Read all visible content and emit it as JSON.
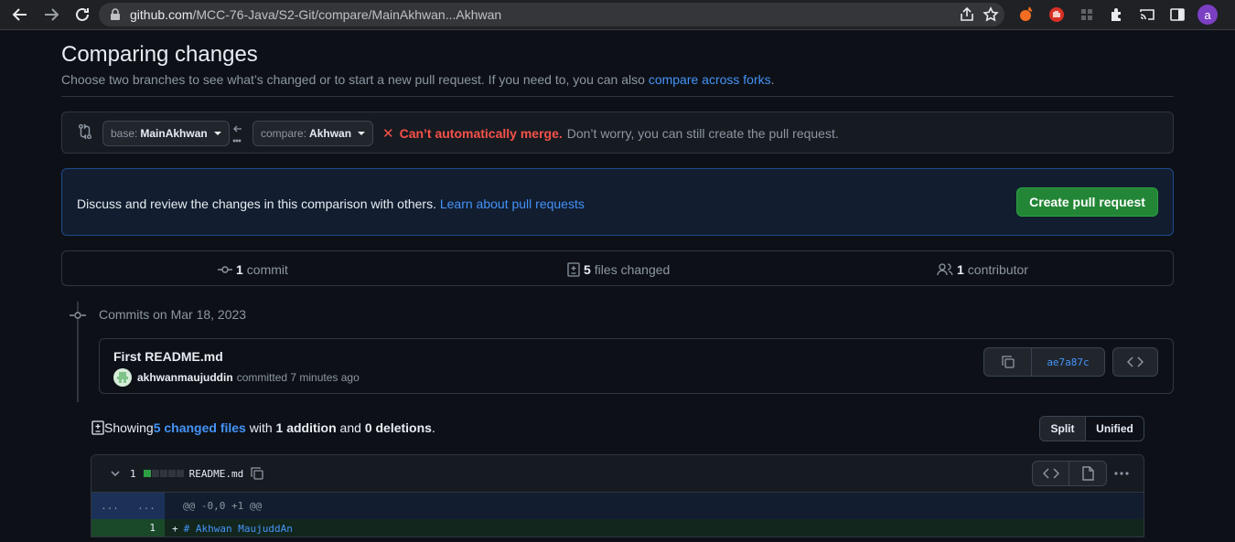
{
  "browser": {
    "url_host": "github.com",
    "url_path": "/MCC-76-Java/S2-Git/compare/MainAkhwan...Akhwan",
    "profile_initial": "a"
  },
  "page": {
    "title": "Comparing changes",
    "subtitle_before": "Choose two branches to see what’s changed or to start a new pull request. If you need to, you can also ",
    "subtitle_link": "compare across forks",
    "subtitle_after": "."
  },
  "range": {
    "base_label": "base:",
    "base_value": "MainAkhwan",
    "compare_label": "compare:",
    "compare_value": "Akhwan",
    "merge_status_strong": "Can’t automatically merge.",
    "merge_status_text": "Don’t worry, you can still create the pull request."
  },
  "banner": {
    "text": "Discuss and review the changes in this comparison with others. ",
    "link": "Learn about pull requests",
    "button": "Create pull request"
  },
  "summary": {
    "commits_count": "1",
    "commits_label": "commit",
    "files_count": "5",
    "files_label": "files changed",
    "contributors_count": "1",
    "contributors_label": "contributor"
  },
  "commits": {
    "date_heading": "Commits on Mar 18, 2023",
    "items": [
      {
        "title": "First README.md",
        "author": "akhwanmaujuddin",
        "meta": "committed 7 minutes ago",
        "sha": "ae7a87c"
      }
    ]
  },
  "diff_summary": {
    "showing": "Showing ",
    "changed_files": "5 changed files",
    "with": " with ",
    "additions": "1 addition",
    "and": " and ",
    "deletions": "0 deletions",
    "end": "."
  },
  "view_toggle": {
    "split": "Split",
    "unified": "Unified"
  },
  "file": {
    "changes_count": "1",
    "name": "README.md",
    "hunk_left": "...",
    "hunk_right": "...",
    "hunk_header": "@@ -0,0 +1 @@",
    "add_line_number": "1",
    "add_sign": "+",
    "add_code": "# Akhwan MaujuddAn"
  },
  "colors": {
    "accent_link": "#4493f8",
    "create_button": "#238636",
    "error": "#f85149",
    "addition": "#2ea043"
  }
}
